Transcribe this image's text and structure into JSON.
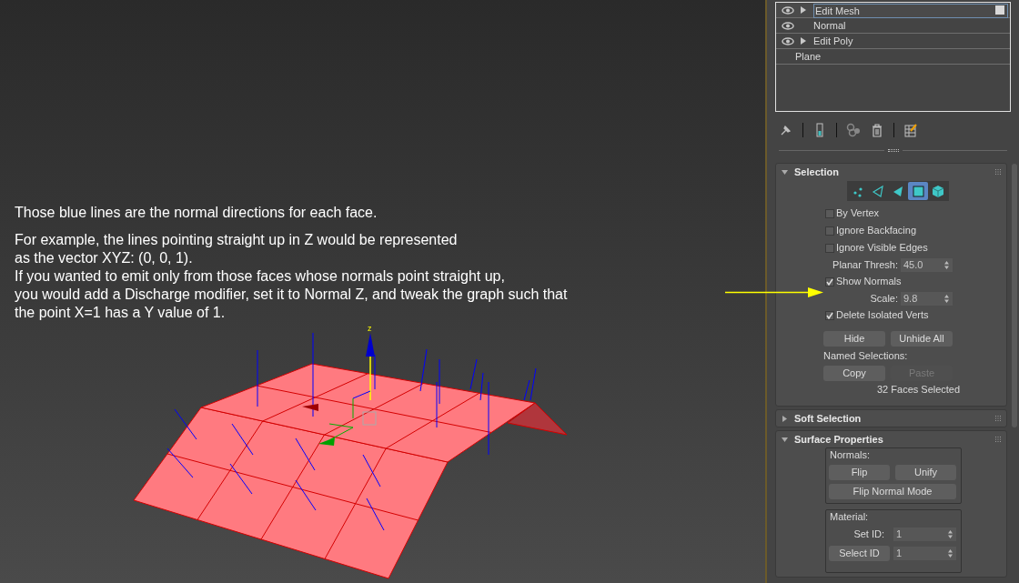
{
  "viewport": {
    "annotation": {
      "paragraphs": [
        "Those blue lines are the normal directions for each face.",
        "For example, the lines pointing straight up in Z would be represented\nas the vector XYZ: (0, 0, 1).\nIf you wanted to emit only from those faces whose normals point straight up,\nyou would add a Discharge modifier, set it to Normal Z, and tweak the graph such that\nthe point X=1 has a Y value of 1."
      ]
    },
    "axis_label": "z"
  },
  "modifier_stack": [
    {
      "label": "Edit Mesh",
      "eye": true,
      "expandable": true,
      "selected": true
    },
    {
      "label": "Normal",
      "eye": true,
      "expandable": false,
      "selected": false
    },
    {
      "label": "Edit Poly",
      "eye": true,
      "expandable": true,
      "selected": false
    },
    {
      "label": "Plane",
      "eye": false,
      "expandable": false,
      "selected": false
    }
  ],
  "selection": {
    "title": "Selection",
    "expanded": true,
    "levels": [
      {
        "kind": "vertex",
        "selected": false
      },
      {
        "kind": "edge",
        "selected": false
      },
      {
        "kind": "face",
        "selected": false
      },
      {
        "kind": "polygon",
        "selected": true
      },
      {
        "kind": "element",
        "selected": false
      }
    ],
    "options": [
      {
        "kind": "checkbox",
        "label": "By Vertex",
        "checked": false
      },
      {
        "kind": "checkbox",
        "label": "Ignore Backfacing",
        "checked": false
      },
      {
        "kind": "checkbox",
        "label": "Ignore Visible Edges",
        "checked": false
      },
      {
        "kind": "spinner",
        "label": "Planar Thresh:",
        "value": "45.0"
      },
      {
        "kind": "checkbox",
        "label": "Show Normals",
        "checked": true
      },
      {
        "kind": "spinner",
        "label": "Scale:",
        "value": "9.8"
      },
      {
        "kind": "checkbox",
        "label": "Delete Isolated Verts",
        "checked": true
      }
    ],
    "buttons": [
      {
        "label": "Hide",
        "disabled": false
      },
      {
        "label": "Unhide All",
        "disabled": false
      }
    ],
    "named_selections_label": "Named Selections:",
    "named_buttons": [
      {
        "label": "Copy",
        "disabled": false
      },
      {
        "label": "Paste",
        "disabled": true
      }
    ],
    "status": "32 Faces Selected"
  },
  "soft_selection": {
    "title": "Soft Selection",
    "expanded": false
  },
  "surface_properties": {
    "title": "Surface Properties",
    "expanded": true,
    "normals": {
      "label": "Normals:",
      "buttons": [
        "Flip",
        "Unify"
      ],
      "wide_button": "Flip Normal Mode"
    },
    "material": {
      "label": "Material:",
      "set_id_label": "Set ID:",
      "set_id": "1",
      "select_id_button": "Select ID",
      "select_id": "1"
    }
  }
}
